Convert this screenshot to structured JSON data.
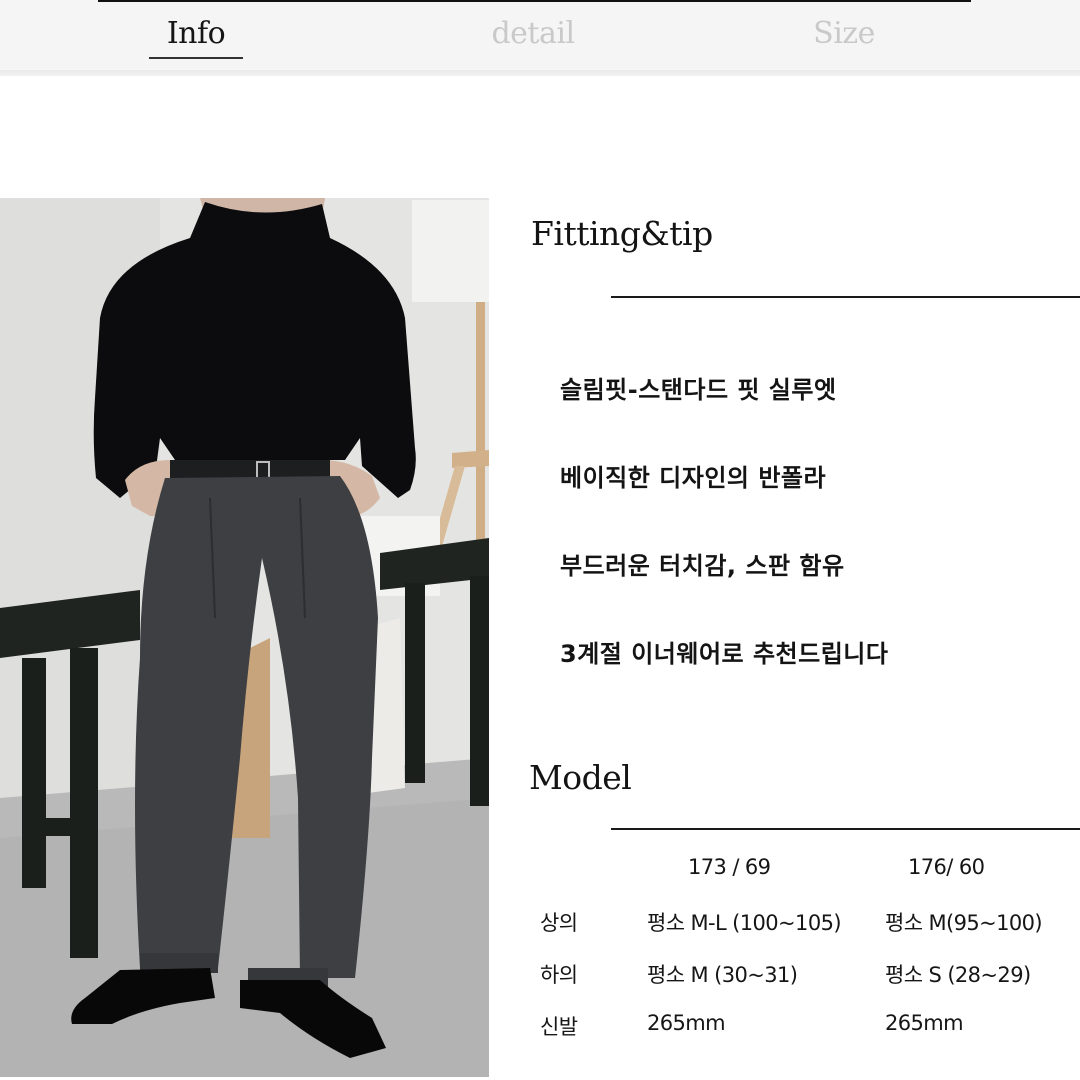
{
  "tabs": [
    {
      "label": "Info",
      "active": true
    },
    {
      "label": "detail",
      "active": false
    },
    {
      "label": "Size",
      "active": false
    }
  ],
  "colors": {
    "header_bg": "#f5f5f5",
    "tab_active": "#151515",
    "tab_inactive": "#c9c9c9",
    "text": "#141414"
  },
  "photo": {
    "description": "Model wearing black mock-neck long sleeve top, grey pleated wide trousers with belt, black square-toe shoes"
  },
  "fitting": {
    "title": "Fitting&tip",
    "tips": [
      "슬림핏-스탠다드 핏 실루엣",
      "베이직한 디자인의 반폴라",
      "부드러운 터치감, 스판 함유",
      "3계절 이너웨어로 추천드립니다"
    ]
  },
  "model": {
    "title": "Model",
    "columns": [
      "173 / 69",
      "176/ 60"
    ],
    "rows": [
      {
        "label": "상의",
        "values": [
          "평소 M-L (100~105)",
          "평소 M(95~100)"
        ]
      },
      {
        "label": "하의",
        "values": [
          "평소 M (30~31)",
          "평소 S (28~29)"
        ]
      },
      {
        "label": "신발",
        "values": [
          "265mm",
          "265mm"
        ]
      }
    ]
  }
}
